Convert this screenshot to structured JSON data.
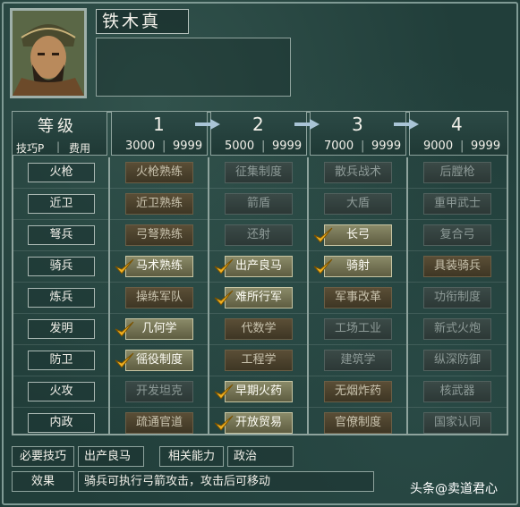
{
  "general": {
    "name": "铁木真"
  },
  "header": {
    "level_label": "等级",
    "points_label": "技巧P",
    "cost_label": "费用",
    "levels": [
      {
        "num": "1",
        "cost": "3000",
        "points": "9999"
      },
      {
        "num": "2",
        "cost": "5000",
        "points": "9999"
      },
      {
        "num": "3",
        "cost": "7000",
        "points": "9999"
      },
      {
        "num": "4",
        "cost": "9000",
        "points": "9999"
      }
    ]
  },
  "rows": [
    {
      "category": "火枪",
      "skills": [
        {
          "label": "火枪熟练",
          "state": "avail",
          "checked": false
        },
        {
          "label": "征集制度",
          "state": "locked",
          "checked": false
        },
        {
          "label": "散兵战术",
          "state": "locked",
          "checked": false
        },
        {
          "label": "后膛枪",
          "state": "locked",
          "checked": false
        }
      ]
    },
    {
      "category": "近卫",
      "skills": [
        {
          "label": "近卫熟练",
          "state": "avail",
          "checked": false
        },
        {
          "label": "箭盾",
          "state": "locked",
          "checked": false
        },
        {
          "label": "大盾",
          "state": "locked",
          "checked": false
        },
        {
          "label": "重甲武士",
          "state": "locked",
          "checked": false
        }
      ]
    },
    {
      "category": "弩兵",
      "skills": [
        {
          "label": "弓弩熟练",
          "state": "avail",
          "checked": false
        },
        {
          "label": "还射",
          "state": "locked",
          "checked": false
        },
        {
          "label": "长弓",
          "state": "learned",
          "checked": true
        },
        {
          "label": "复合弓",
          "state": "locked",
          "checked": false
        }
      ]
    },
    {
      "category": "骑兵",
      "skills": [
        {
          "label": "马术熟练",
          "state": "learned",
          "checked": true
        },
        {
          "label": "出产良马",
          "state": "learned",
          "checked": true
        },
        {
          "label": "骑射",
          "state": "learned",
          "checked": true
        },
        {
          "label": "具装骑兵",
          "state": "avail",
          "checked": false
        }
      ]
    },
    {
      "category": "炼兵",
      "skills": [
        {
          "label": "操练军队",
          "state": "avail",
          "checked": false
        },
        {
          "label": "难所行军",
          "state": "learned",
          "checked": true
        },
        {
          "label": "军事改革",
          "state": "avail",
          "checked": false
        },
        {
          "label": "功衔制度",
          "state": "locked",
          "checked": false
        }
      ]
    },
    {
      "category": "发明",
      "skills": [
        {
          "label": "几何学",
          "state": "learned",
          "checked": true
        },
        {
          "label": "代数学",
          "state": "avail",
          "checked": false
        },
        {
          "label": "工场工业",
          "state": "locked",
          "checked": false
        },
        {
          "label": "新式火炮",
          "state": "locked",
          "checked": false
        }
      ]
    },
    {
      "category": "防卫",
      "skills": [
        {
          "label": "徭役制度",
          "state": "learned",
          "checked": true
        },
        {
          "label": "工程学",
          "state": "avail",
          "checked": false
        },
        {
          "label": "建筑学",
          "state": "locked",
          "checked": false
        },
        {
          "label": "纵深防御",
          "state": "locked",
          "checked": false
        }
      ]
    },
    {
      "category": "火攻",
      "skills": [
        {
          "label": "开发坦克",
          "state": "locked",
          "checked": false
        },
        {
          "label": "早期火药",
          "state": "learned",
          "checked": true
        },
        {
          "label": "无烟炸药",
          "state": "avail",
          "checked": false
        },
        {
          "label": "核武器",
          "state": "locked",
          "checked": false
        }
      ]
    },
    {
      "category": "内政",
      "skills": [
        {
          "label": "疏通官道",
          "state": "avail",
          "checked": false
        },
        {
          "label": "开放贸易",
          "state": "learned",
          "checked": true
        },
        {
          "label": "官僚制度",
          "state": "avail",
          "checked": false
        },
        {
          "label": "国家认同",
          "state": "locked",
          "checked": false
        }
      ]
    }
  ],
  "footer": {
    "required_label": "必要技巧",
    "required_value": "出产良马",
    "related_label": "相关能力",
    "related_value": "政治",
    "effect_label": "效果",
    "effect_value": "骑兵可执行弓箭攻击，攻击后可移动"
  },
  "watermark": {
    "text": "头条@卖道君心"
  },
  "colors": {
    "learned": "#7a7a5a",
    "available": "#4c4330",
    "locked": "#34423f",
    "check": "#f0b020"
  }
}
